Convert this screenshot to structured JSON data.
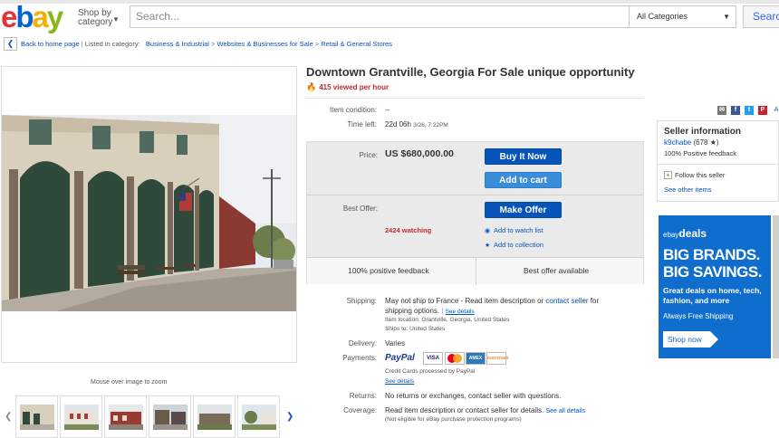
{
  "header": {
    "logo": [
      "e",
      "b",
      "a",
      "y"
    ],
    "logo_colors": [
      "#e53238",
      "#0064d2",
      "#f5af02",
      "#86b817"
    ],
    "shop_by_line1": "Shop by",
    "shop_by_line2": "category",
    "search_placeholder": "Search...",
    "category_select": "All Categories",
    "search_button": "Search"
  },
  "breadcrumb": {
    "back_label": "Back to home page",
    "listed_in": "Listed in category:",
    "items": [
      "Business & Industrial",
      "Websites & Businesses for Sale",
      "Retail & General Stores"
    ]
  },
  "gallery": {
    "zoom_note": "Mouse over image to zoom"
  },
  "item": {
    "title": "Downtown Grantville, Georgia For Sale unique opportunity",
    "viewed": "415 viewed per hour",
    "condition_label": "Item condition:",
    "condition_value": "--",
    "time_left_label": "Time left:",
    "time_left_value": "22d 06h",
    "time_left_date": "3/26, 7:22PM",
    "price_label": "Price:",
    "price_value": "US $680,000.00",
    "buy_now": "Buy It Now",
    "add_to_cart": "Add to cart",
    "best_offer_label": "Best Offer:",
    "make_offer": "Make Offer",
    "watching": "2424 watching",
    "add_watch": "Add to watch list",
    "add_collection": "Add to collection",
    "positive_feedback": "100% positive feedback",
    "best_offer_available": "Best offer available"
  },
  "details": {
    "shipping_label": "Shipping:",
    "shipping_text1": "May not ship to France - Read item description or",
    "shipping_link": "contact seller",
    "shipping_text2": "for",
    "shipping_text3": "shipping options.",
    "see_details": "See details",
    "item_location": "Item location:  Grantville, Georgia, United States",
    "ships_to": "Ships to:  United States",
    "delivery_label": "Delivery:",
    "delivery_value": "Varies",
    "payments_label": "Payments:",
    "paypal": "PayPal",
    "cards": [
      "VISA",
      "MC",
      "AMEX",
      "DISCOVER"
    ],
    "credit_cards": "Credit Cards processed by PayPal",
    "see_details2": "See details",
    "returns_label": "Returns:",
    "returns_value": "No returns or exchanges, contact seller with questions.",
    "coverage_label": "Coverage:",
    "coverage_value": "Read item description or contact seller for details.",
    "see_all_details": "See all details",
    "coverage_note": "(Not eligible for eBay purchase protection programs)"
  },
  "seller": {
    "heading": "Seller information",
    "name": "k9chabe",
    "score": "(678 ★)",
    "feedback": "100% Positive feedback",
    "follow": "Follow this seller",
    "other_items": "See other items"
  },
  "social": [
    "✉",
    "f",
    "t",
    "P",
    "A"
  ],
  "ad": {
    "brand": "ebay",
    "brand_suffix": "deals",
    "line1": "BIG BRANDS.",
    "line2": "BIG SAVINGS.",
    "sub": "Great deals on home, tech, fashion, and more",
    "free_shipping": "Always Free Shipping",
    "shop_now": "Shop now"
  }
}
